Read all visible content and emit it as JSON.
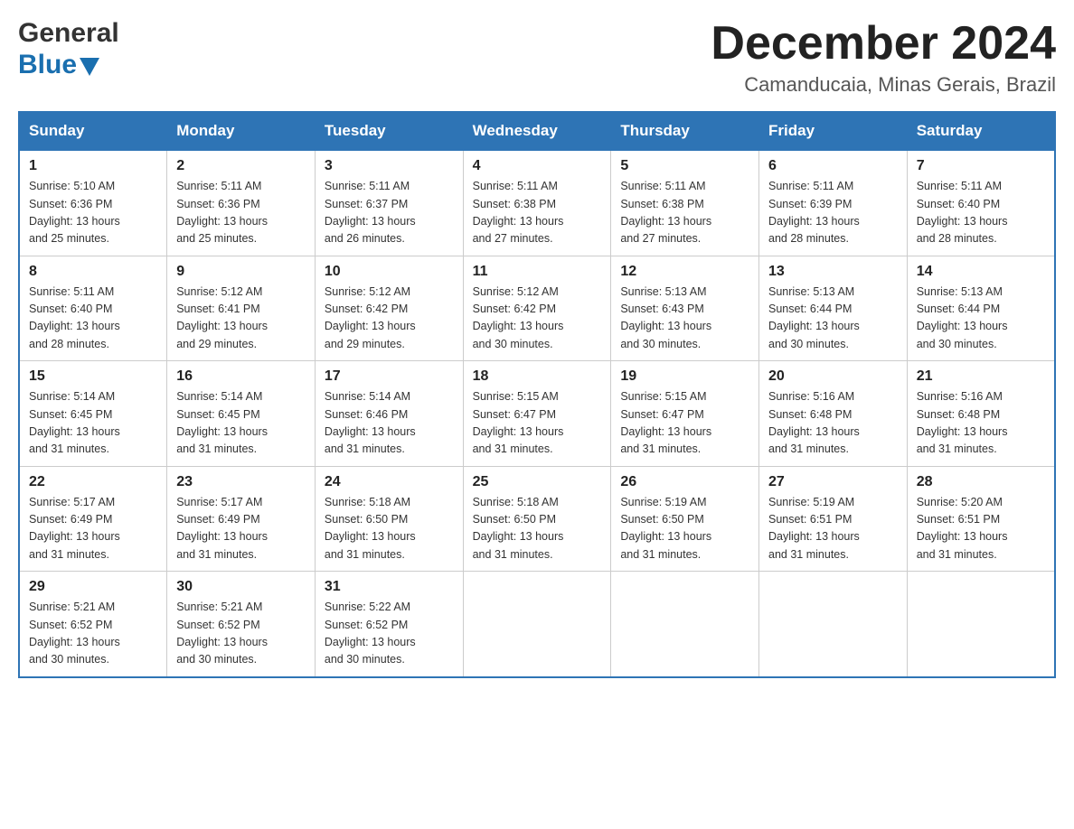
{
  "header": {
    "logo_line1": "General",
    "logo_line2": "Blue",
    "title": "December 2024",
    "subtitle": "Camanducaia, Minas Gerais, Brazil"
  },
  "weekdays": [
    "Sunday",
    "Monday",
    "Tuesday",
    "Wednesday",
    "Thursday",
    "Friday",
    "Saturday"
  ],
  "weeks": [
    [
      {
        "day": "1",
        "sunrise": "5:10 AM",
        "sunset": "6:36 PM",
        "daylight": "13 hours and 25 minutes."
      },
      {
        "day": "2",
        "sunrise": "5:11 AM",
        "sunset": "6:36 PM",
        "daylight": "13 hours and 25 minutes."
      },
      {
        "day": "3",
        "sunrise": "5:11 AM",
        "sunset": "6:37 PM",
        "daylight": "13 hours and 26 minutes."
      },
      {
        "day": "4",
        "sunrise": "5:11 AM",
        "sunset": "6:38 PM",
        "daylight": "13 hours and 27 minutes."
      },
      {
        "day": "5",
        "sunrise": "5:11 AM",
        "sunset": "6:38 PM",
        "daylight": "13 hours and 27 minutes."
      },
      {
        "day": "6",
        "sunrise": "5:11 AM",
        "sunset": "6:39 PM",
        "daylight": "13 hours and 28 minutes."
      },
      {
        "day": "7",
        "sunrise": "5:11 AM",
        "sunset": "6:40 PM",
        "daylight": "13 hours and 28 minutes."
      }
    ],
    [
      {
        "day": "8",
        "sunrise": "5:11 AM",
        "sunset": "6:40 PM",
        "daylight": "13 hours and 28 minutes."
      },
      {
        "day": "9",
        "sunrise": "5:12 AM",
        "sunset": "6:41 PM",
        "daylight": "13 hours and 29 minutes."
      },
      {
        "day": "10",
        "sunrise": "5:12 AM",
        "sunset": "6:42 PM",
        "daylight": "13 hours and 29 minutes."
      },
      {
        "day": "11",
        "sunrise": "5:12 AM",
        "sunset": "6:42 PM",
        "daylight": "13 hours and 30 minutes."
      },
      {
        "day": "12",
        "sunrise": "5:13 AM",
        "sunset": "6:43 PM",
        "daylight": "13 hours and 30 minutes."
      },
      {
        "day": "13",
        "sunrise": "5:13 AM",
        "sunset": "6:44 PM",
        "daylight": "13 hours and 30 minutes."
      },
      {
        "day": "14",
        "sunrise": "5:13 AM",
        "sunset": "6:44 PM",
        "daylight": "13 hours and 30 minutes."
      }
    ],
    [
      {
        "day": "15",
        "sunrise": "5:14 AM",
        "sunset": "6:45 PM",
        "daylight": "13 hours and 31 minutes."
      },
      {
        "day": "16",
        "sunrise": "5:14 AM",
        "sunset": "6:45 PM",
        "daylight": "13 hours and 31 minutes."
      },
      {
        "day": "17",
        "sunrise": "5:14 AM",
        "sunset": "6:46 PM",
        "daylight": "13 hours and 31 minutes."
      },
      {
        "day": "18",
        "sunrise": "5:15 AM",
        "sunset": "6:47 PM",
        "daylight": "13 hours and 31 minutes."
      },
      {
        "day": "19",
        "sunrise": "5:15 AM",
        "sunset": "6:47 PM",
        "daylight": "13 hours and 31 minutes."
      },
      {
        "day": "20",
        "sunrise": "5:16 AM",
        "sunset": "6:48 PM",
        "daylight": "13 hours and 31 minutes."
      },
      {
        "day": "21",
        "sunrise": "5:16 AM",
        "sunset": "6:48 PM",
        "daylight": "13 hours and 31 minutes."
      }
    ],
    [
      {
        "day": "22",
        "sunrise": "5:17 AM",
        "sunset": "6:49 PM",
        "daylight": "13 hours and 31 minutes."
      },
      {
        "day": "23",
        "sunrise": "5:17 AM",
        "sunset": "6:49 PM",
        "daylight": "13 hours and 31 minutes."
      },
      {
        "day": "24",
        "sunrise": "5:18 AM",
        "sunset": "6:50 PM",
        "daylight": "13 hours and 31 minutes."
      },
      {
        "day": "25",
        "sunrise": "5:18 AM",
        "sunset": "6:50 PM",
        "daylight": "13 hours and 31 minutes."
      },
      {
        "day": "26",
        "sunrise": "5:19 AM",
        "sunset": "6:50 PM",
        "daylight": "13 hours and 31 minutes."
      },
      {
        "day": "27",
        "sunrise": "5:19 AM",
        "sunset": "6:51 PM",
        "daylight": "13 hours and 31 minutes."
      },
      {
        "day": "28",
        "sunrise": "5:20 AM",
        "sunset": "6:51 PM",
        "daylight": "13 hours and 31 minutes."
      }
    ],
    [
      {
        "day": "29",
        "sunrise": "5:21 AM",
        "sunset": "6:52 PM",
        "daylight": "13 hours and 30 minutes."
      },
      {
        "day": "30",
        "sunrise": "5:21 AM",
        "sunset": "6:52 PM",
        "daylight": "13 hours and 30 minutes."
      },
      {
        "day": "31",
        "sunrise": "5:22 AM",
        "sunset": "6:52 PM",
        "daylight": "13 hours and 30 minutes."
      },
      null,
      null,
      null,
      null
    ]
  ],
  "labels": {
    "sunrise": "Sunrise:",
    "sunset": "Sunset:",
    "daylight": "Daylight:"
  }
}
